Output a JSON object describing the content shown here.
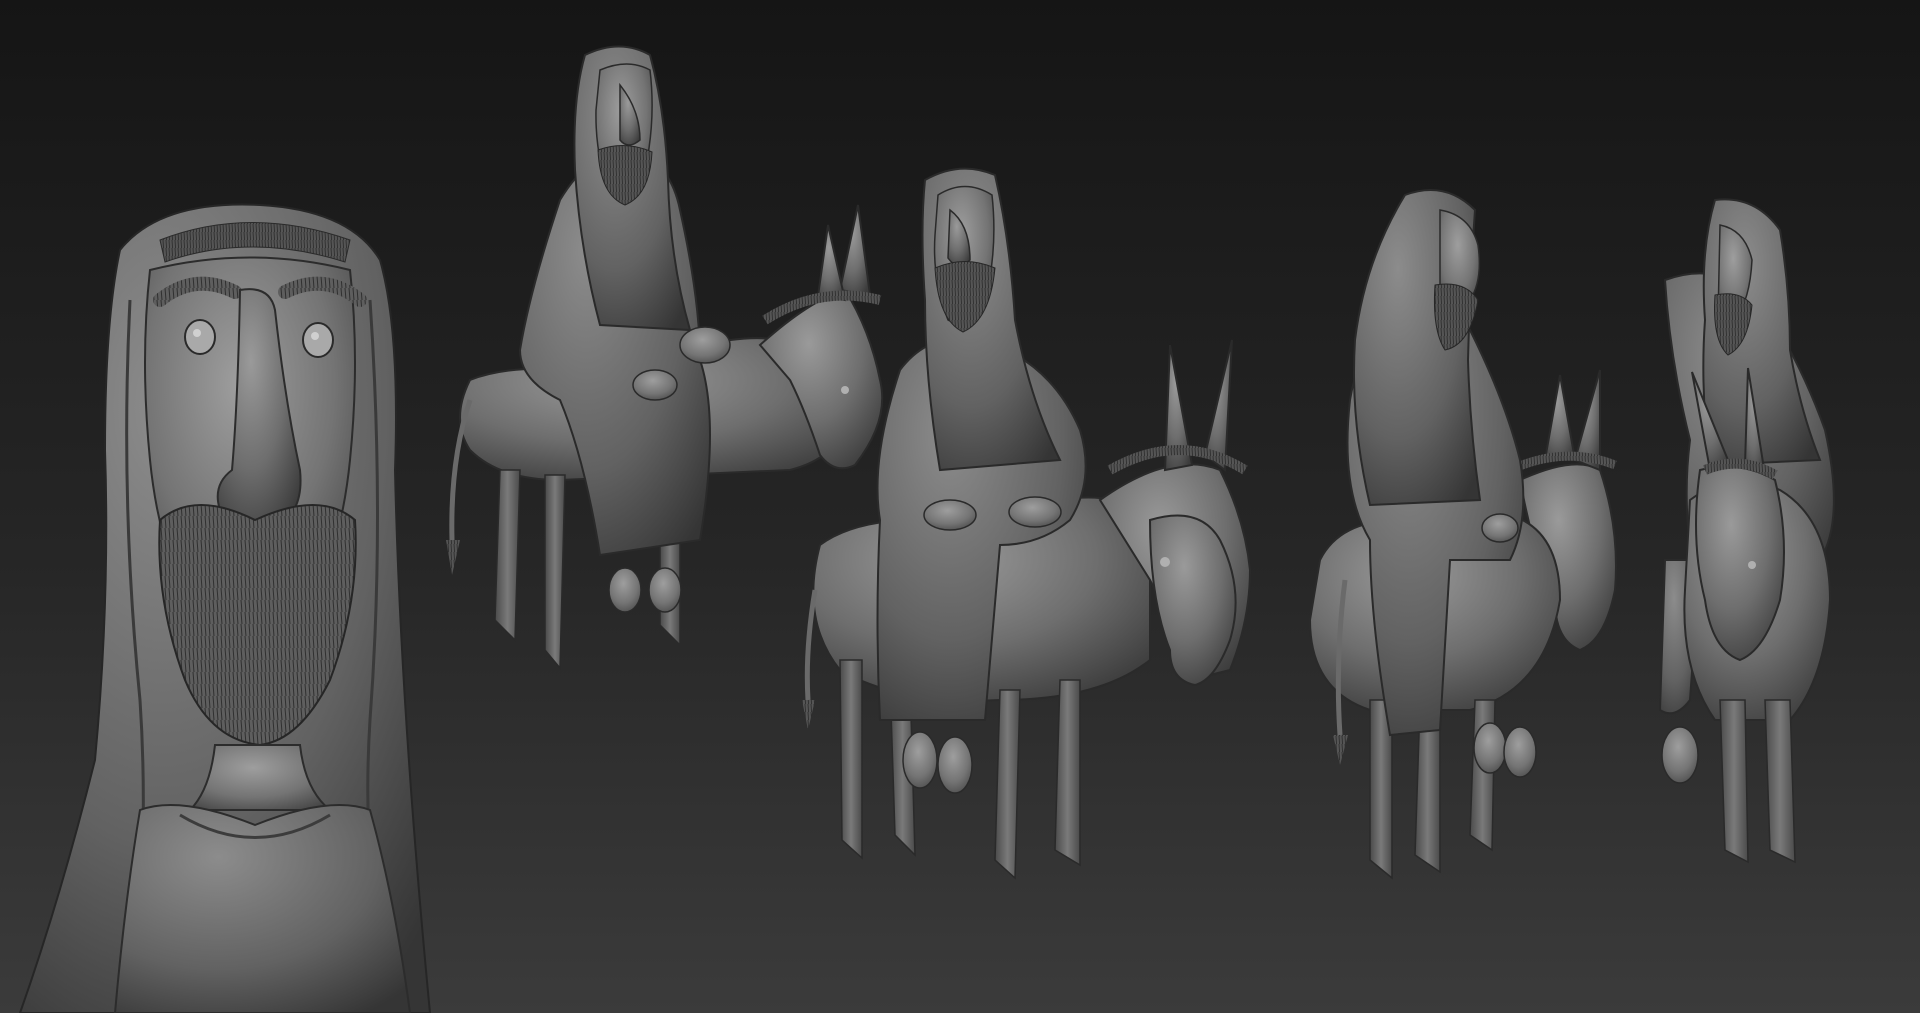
{
  "render": {
    "style": "clay-sculpt",
    "background_top": "#161616",
    "background_bottom": "#3a3a3a",
    "clay_light": "#8e8e8e",
    "clay_mid": "#6c6c6c",
    "clay_dark": "#3f3f3f",
    "clay_shadow": "#2a2a2a",
    "line": "#1e1e1e"
  },
  "figures": [
    {
      "label_name": "bust-closeup"
    },
    {
      "label_name": "rider-three-quarter-left"
    },
    {
      "label_name": "rider-front-three-quarter"
    },
    {
      "label_name": "rider-three-quarter-back"
    },
    {
      "label_name": "rider-front"
    }
  ]
}
